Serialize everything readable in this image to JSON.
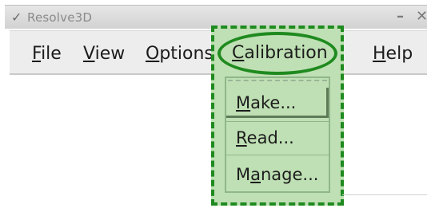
{
  "window": {
    "title": "Resolve3D",
    "icons": {
      "menu": "chevron-down-icon",
      "minimize": "minimize-icon",
      "close": "close-icon"
    }
  },
  "menubar": {
    "file": {
      "first": "F",
      "rest": "ile"
    },
    "view": {
      "first": "V",
      "rest": "iew"
    },
    "options": {
      "first": "O",
      "rest": "ptions"
    },
    "calibration": {
      "first": "C",
      "rest": "alibration"
    },
    "help": {
      "first": "H",
      "rest": "elp"
    }
  },
  "dropdown": {
    "items": [
      {
        "first": "M",
        "rest": "ake...",
        "state": "hovered"
      },
      {
        "first": "R",
        "rest": "ead...",
        "state": "normal"
      },
      {
        "pre": "M",
        "u": "a",
        "rest": "nage...",
        "state": "normal"
      }
    ]
  },
  "highlight": {
    "color": "#1f8a1f",
    "fill": "#bfe0b4"
  }
}
